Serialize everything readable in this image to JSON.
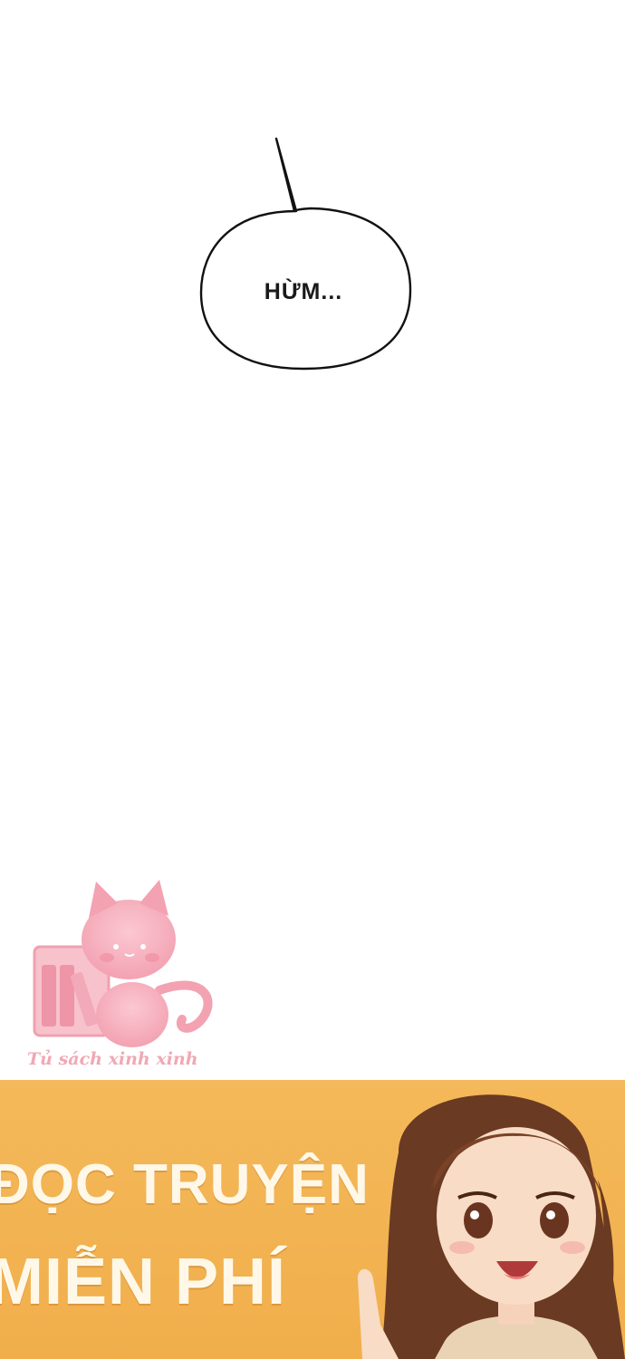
{
  "speech_bubble": {
    "text": "HỪM..."
  },
  "watermark": {
    "text": "Tủ sách xinh xinh",
    "color": "#f0a8b4"
  },
  "banner": {
    "line1": "ĐỌC TRUYỆN",
    "line2": "MIỄN PHÍ",
    "background": "#f2b24f",
    "text_color": "#fff8e8"
  }
}
